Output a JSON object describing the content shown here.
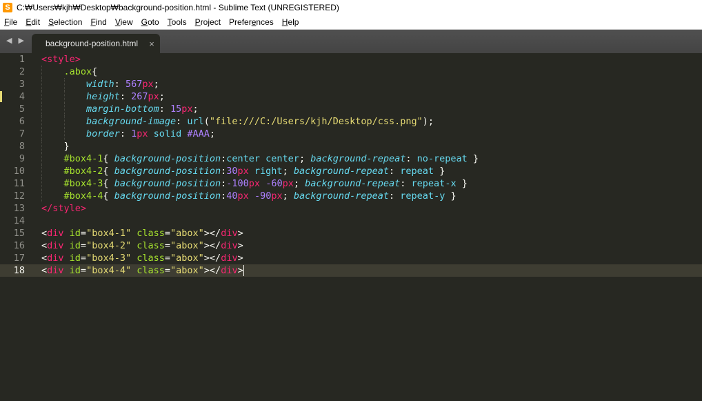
{
  "window": {
    "title": "C:₩Users₩kjh₩Desktop₩background-position.html - Sublime Text (UNREGISTERED)",
    "app_icon": "S"
  },
  "menu": [
    {
      "mnemonic": "F",
      "rest": "ile"
    },
    {
      "mnemonic": "E",
      "rest": "dit"
    },
    {
      "mnemonic": "S",
      "rest": "election"
    },
    {
      "mnemonic": "F",
      "rest": "ind"
    },
    {
      "mnemonic": "V",
      "rest": "iew"
    },
    {
      "mnemonic": "G",
      "rest": "oto"
    },
    {
      "mnemonic": "T",
      "rest": "ools"
    },
    {
      "mnemonic": "P",
      "rest": "roject"
    },
    {
      "pre": "Prefer",
      "mnemonic": "e",
      "rest": "nces"
    },
    {
      "mnemonic": "H",
      "rest": "elp"
    }
  ],
  "tabs": {
    "nav_arrows": "◀ ▶",
    "active": {
      "label": "background-position.html",
      "close": "×"
    }
  },
  "editor": {
    "current_line": 18,
    "modified_lines": [
      4
    ],
    "lines": [
      {
        "num": "1",
        "indent": 0,
        "tokens": [
          [
            "tag",
            "<style>"
          ]
        ]
      },
      {
        "num": "2",
        "indent": 1,
        "tokens": [
          [
            "sel",
            ".abox"
          ],
          [
            "punc",
            "{"
          ]
        ]
      },
      {
        "num": "3",
        "indent": 2,
        "tokens": [
          [
            "prop",
            "width"
          ],
          [
            "punc",
            ": "
          ],
          [
            "num",
            "567"
          ],
          [
            "unit",
            "px"
          ],
          [
            "punc",
            ";"
          ]
        ]
      },
      {
        "num": "4",
        "indent": 2,
        "tokens": [
          [
            "prop",
            "height"
          ],
          [
            "punc",
            ": "
          ],
          [
            "num",
            "267"
          ],
          [
            "unit",
            "px"
          ],
          [
            "punc",
            ";"
          ]
        ]
      },
      {
        "num": "5",
        "indent": 2,
        "tokens": [
          [
            "prop",
            "margin-bottom"
          ],
          [
            "punc",
            ": "
          ],
          [
            "num",
            "15"
          ],
          [
            "unit",
            "px"
          ],
          [
            "punc",
            ";"
          ]
        ]
      },
      {
        "num": "6",
        "indent": 2,
        "tokens": [
          [
            "prop",
            "background-image"
          ],
          [
            "punc",
            ": "
          ],
          [
            "val",
            "url"
          ],
          [
            "punc",
            "("
          ],
          [
            "str",
            "\"file:///C:/Users/kjh/Desktop/css.png\""
          ],
          [
            "punc",
            ");"
          ]
        ]
      },
      {
        "num": "7",
        "indent": 2,
        "tokens": [
          [
            "prop",
            "border"
          ],
          [
            "punc",
            ": "
          ],
          [
            "num",
            "1"
          ],
          [
            "unit",
            "px"
          ],
          [
            "val",
            " solid "
          ],
          [
            "num",
            "#AAA"
          ],
          [
            "punc",
            ";"
          ]
        ]
      },
      {
        "num": "8",
        "indent": 1,
        "tokens": [
          [
            "punc",
            "}"
          ]
        ]
      },
      {
        "num": "9",
        "indent": 1,
        "tokens": [
          [
            "sel",
            "#box4-1"
          ],
          [
            "punc",
            "{ "
          ],
          [
            "prop",
            "background-position"
          ],
          [
            "punc",
            ":"
          ],
          [
            "val",
            "center center"
          ],
          [
            "punc",
            "; "
          ],
          [
            "prop",
            "background-repeat"
          ],
          [
            "punc",
            ": "
          ],
          [
            "val",
            "no-repeat"
          ],
          [
            "punc",
            " }"
          ]
        ]
      },
      {
        "num": "10",
        "indent": 1,
        "tokens": [
          [
            "sel",
            "#box4-2"
          ],
          [
            "punc",
            "{ "
          ],
          [
            "prop",
            "background-position"
          ],
          [
            "punc",
            ":"
          ],
          [
            "num",
            "30"
          ],
          [
            "unit",
            "px"
          ],
          [
            "val",
            " right"
          ],
          [
            "punc",
            "; "
          ],
          [
            "prop",
            "background-repeat"
          ],
          [
            "punc",
            ": "
          ],
          [
            "val",
            "repeat"
          ],
          [
            "punc",
            " }"
          ]
        ]
      },
      {
        "num": "11",
        "indent": 1,
        "tokens": [
          [
            "sel",
            "#box4-3"
          ],
          [
            "punc",
            "{ "
          ],
          [
            "prop",
            "background-position"
          ],
          [
            "punc",
            ":"
          ],
          [
            "num",
            "-100"
          ],
          [
            "unit",
            "px"
          ],
          [
            "punc",
            " "
          ],
          [
            "num",
            "-60"
          ],
          [
            "unit",
            "px"
          ],
          [
            "punc",
            "; "
          ],
          [
            "prop",
            "background-repeat"
          ],
          [
            "punc",
            ": "
          ],
          [
            "val",
            "repeat-x"
          ],
          [
            "punc",
            " }"
          ]
        ]
      },
      {
        "num": "12",
        "indent": 1,
        "tokens": [
          [
            "sel",
            "#box4-4"
          ],
          [
            "punc",
            "{ "
          ],
          [
            "prop",
            "background-position"
          ],
          [
            "punc",
            ":"
          ],
          [
            "num",
            "40"
          ],
          [
            "unit",
            "px"
          ],
          [
            "punc",
            " "
          ],
          [
            "num",
            "-90"
          ],
          [
            "unit",
            "px"
          ],
          [
            "punc",
            "; "
          ],
          [
            "prop",
            "background-repeat"
          ],
          [
            "punc",
            ": "
          ],
          [
            "val",
            "repeat-y"
          ],
          [
            "punc",
            " }"
          ]
        ]
      },
      {
        "num": "13",
        "indent": 0,
        "tokens": [
          [
            "tag",
            "</style>"
          ]
        ]
      },
      {
        "num": "14",
        "indent": 0,
        "tokens": []
      },
      {
        "num": "15",
        "indent": 0,
        "tokens": [
          [
            "punc",
            "<"
          ],
          [
            "tag",
            "div"
          ],
          [
            "attr",
            " id"
          ],
          [
            "punc",
            "="
          ],
          [
            "str",
            "\"box4-1\""
          ],
          [
            "attr",
            " class"
          ],
          [
            "punc",
            "="
          ],
          [
            "str",
            "\"abox\""
          ],
          [
            "punc",
            "></"
          ],
          [
            "tag",
            "div"
          ],
          [
            "punc",
            ">"
          ]
        ]
      },
      {
        "num": "16",
        "indent": 0,
        "tokens": [
          [
            "punc",
            "<"
          ],
          [
            "tag",
            "div"
          ],
          [
            "attr",
            " id"
          ],
          [
            "punc",
            "="
          ],
          [
            "str",
            "\"box4-2\""
          ],
          [
            "attr",
            " class"
          ],
          [
            "punc",
            "="
          ],
          [
            "str",
            "\"abox\""
          ],
          [
            "punc",
            "></"
          ],
          [
            "tag",
            "div"
          ],
          [
            "punc",
            ">"
          ]
        ]
      },
      {
        "num": "17",
        "indent": 0,
        "tokens": [
          [
            "punc",
            "<"
          ],
          [
            "tag",
            "div"
          ],
          [
            "attr",
            " id"
          ],
          [
            "punc",
            "="
          ],
          [
            "str",
            "\"box4-3\""
          ],
          [
            "attr",
            " class"
          ],
          [
            "punc",
            "="
          ],
          [
            "str",
            "\"abox\""
          ],
          [
            "punc",
            "></"
          ],
          [
            "tag",
            "div"
          ],
          [
            "punc",
            ">"
          ]
        ]
      },
      {
        "num": "18",
        "indent": 0,
        "tokens": [
          [
            "punc",
            "<"
          ],
          [
            "tag",
            "div"
          ],
          [
            "attr",
            " id"
          ],
          [
            "punc",
            "="
          ],
          [
            "str",
            "\"box4-4\""
          ],
          [
            "attr",
            " class"
          ],
          [
            "punc",
            "="
          ],
          [
            "str",
            "\"abox\""
          ],
          [
            "punc",
            "></"
          ],
          [
            "tag",
            "div"
          ],
          [
            "punc",
            ">"
          ]
        ]
      }
    ]
  }
}
